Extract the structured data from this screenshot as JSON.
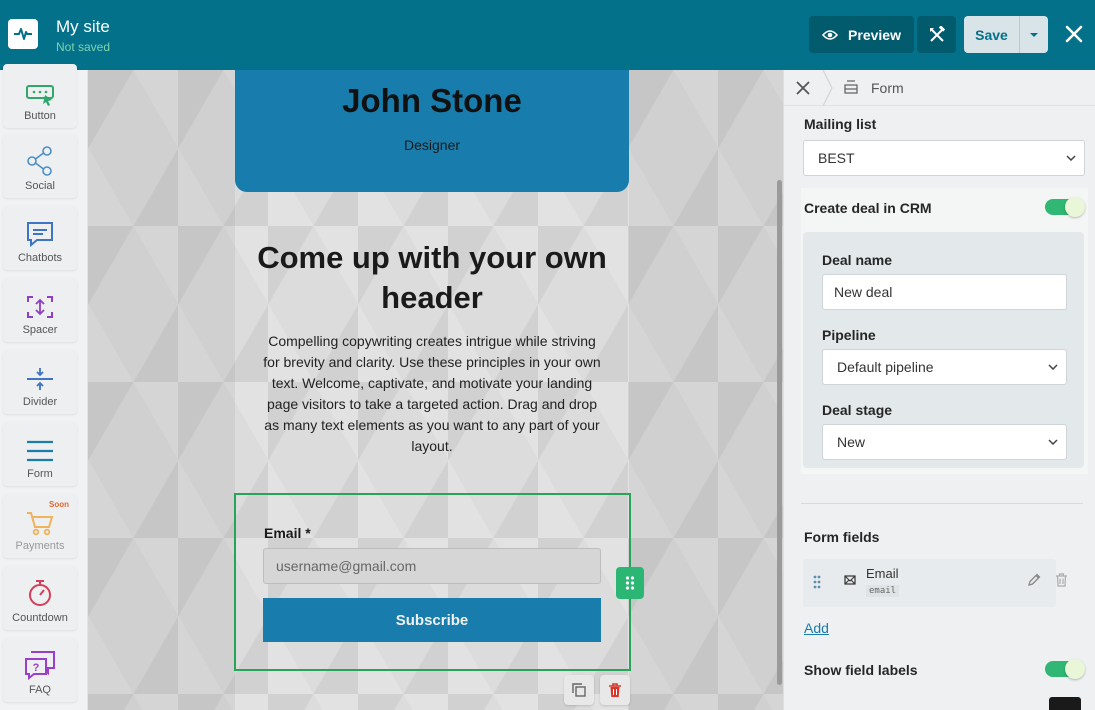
{
  "topbar": {
    "site_title": "My site",
    "site_status": "Not saved",
    "preview_label": "Preview",
    "save_label": "Save"
  },
  "sidebar": {
    "widgets": [
      {
        "label": "Button",
        "icon": "cursor-click-icon"
      },
      {
        "label": "Social",
        "icon": "share-icon"
      },
      {
        "label": "Chatbots",
        "icon": "chat-bubble-icon"
      },
      {
        "label": "Spacer",
        "icon": "spacer-icon"
      },
      {
        "label": "Divider",
        "icon": "divider-icon"
      },
      {
        "label": "Form",
        "icon": "form-lines-icon"
      },
      {
        "label": "Payments",
        "icon": "cart-icon",
        "badge": "Soon"
      },
      {
        "label": "Countdown",
        "icon": "stopwatch-icon"
      },
      {
        "label": "FAQ",
        "icon": "faq-icon"
      }
    ]
  },
  "canvas": {
    "profile_name": "John Stone",
    "profile_role": "Designer",
    "header": "Come up with your own header",
    "body": "Compelling copywriting creates intrigue while striving for brevity and clarity. Use these principles in your own text. Welcome, captivate, and motivate your landing page visitors to take a targeted action. Drag and drop as many text elements as you want to any part of your layout.",
    "email_label": "Email *",
    "email_placeholder": "username@gmail.com",
    "subscribe_label": "Subscribe"
  },
  "panel": {
    "breadcrumb_label": "Form",
    "mailing_list_label": "Mailing list",
    "mailing_list_value": "BEST",
    "create_deal_label": "Create deal in CRM",
    "create_deal_enabled": true,
    "deal_name_label": "Deal name",
    "deal_name_value": "New deal",
    "pipeline_label": "Pipeline",
    "pipeline_value": "Default pipeline",
    "deal_stage_label": "Deal stage",
    "deal_stage_value": "New",
    "form_fields_label": "Form fields",
    "fields": [
      {
        "name": "Email",
        "type": "email"
      }
    ],
    "add_label": "Add",
    "show_field_labels_label": "Show field labels",
    "show_field_labels_enabled": true
  },
  "colors": {
    "topbar": "#027189",
    "accent_green": "#2fb773",
    "card_blue": "#187dad"
  }
}
